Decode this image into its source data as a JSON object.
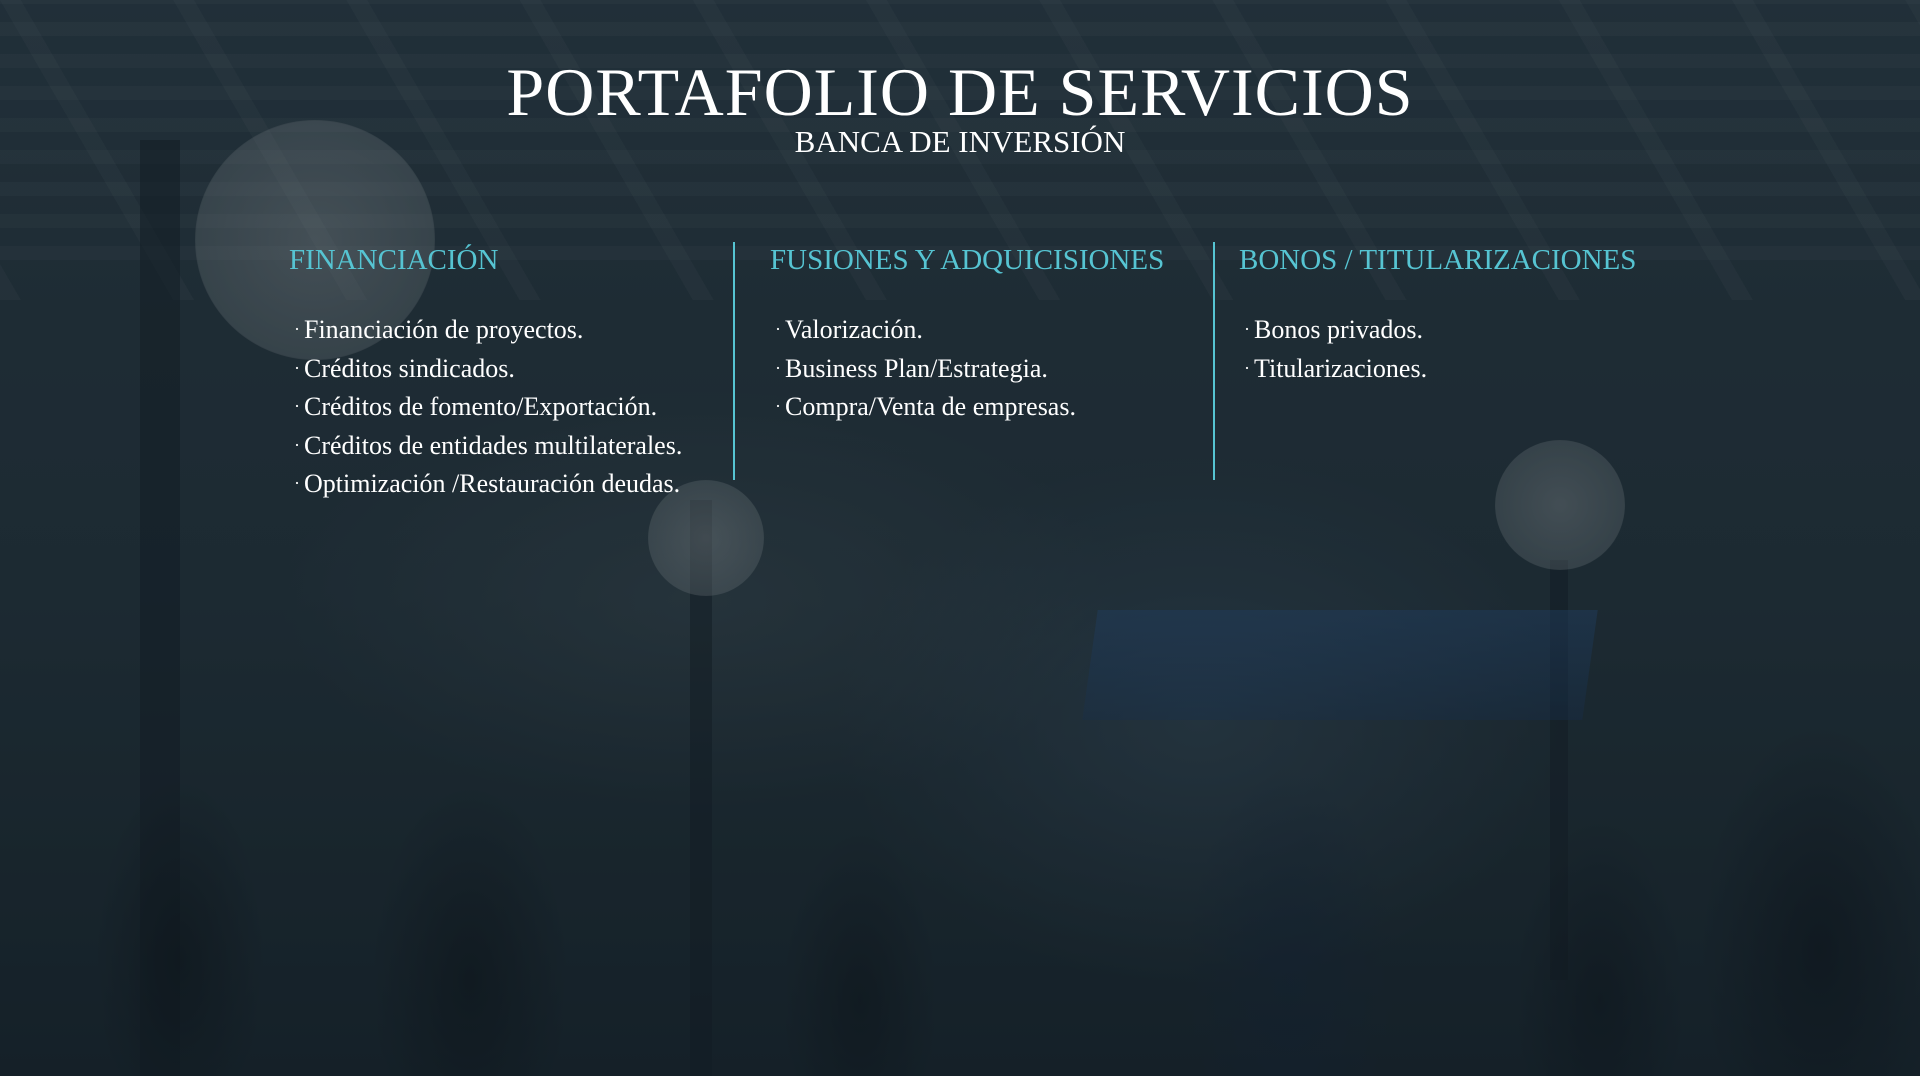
{
  "header": {
    "title": "PORTAFOLIO DE SERVICIOS",
    "subtitle": "BANCA DE INVERSIÓN"
  },
  "colors": {
    "accent": "#56c4d2",
    "text": "#ffffff"
  },
  "columns": [
    {
      "title": "FINANCIACIÓN",
      "items": [
        "Financiación de proyectos.",
        "Créditos sindicados.",
        "Créditos de fomento/Exportación.",
        "Créditos de entidades multilaterales.",
        "Optimización /Restauración deudas."
      ]
    },
    {
      "title": "FUSIONES Y ADQUICISIONES",
      "items": [
        "Valorización.",
        "Business Plan/Estrategia.",
        "Compra/Venta de empresas."
      ]
    },
    {
      "title": "BONOS / TITULARIZACIONES",
      "items": [
        "Bonos privados.",
        "Titularizaciones."
      ]
    }
  ]
}
